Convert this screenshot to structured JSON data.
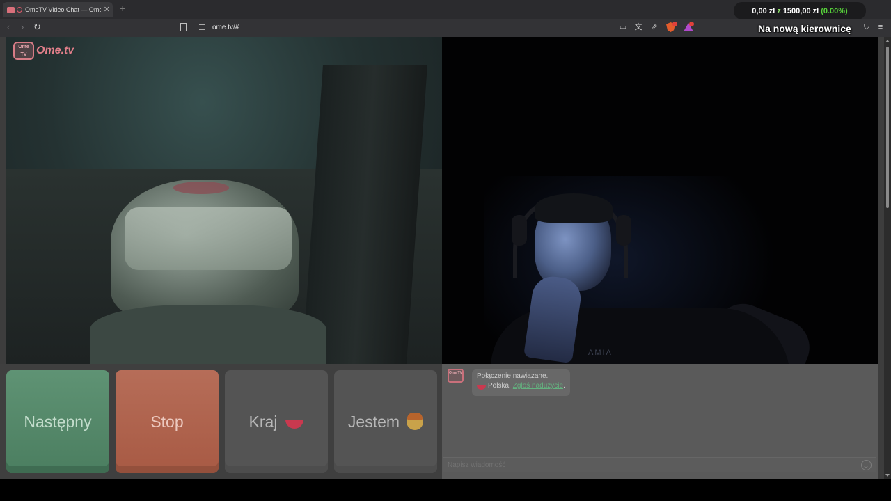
{
  "browser": {
    "tab_title": "OmeTV Video Chat — Omegle",
    "tab_close": "✕",
    "new_tab": "+",
    "url": "ome.tv/#",
    "nav": {
      "back": "‹",
      "forward": "›",
      "reload": "↻"
    },
    "toolbar_icons": [
      "screen-cast-icon",
      "translate-icon",
      "share-icon",
      "brave-shields-icon",
      "brave-rewards-icon",
      "sidebar-icon",
      "wallet-icon",
      "vpn-icon",
      "menu-icon"
    ]
  },
  "stream_overlay": {
    "amount": "0,00 zł",
    "z": "z",
    "goal": "1500,00 zł",
    "percent": "(0.00%)",
    "title": "Na nową kierownicę"
  },
  "site": {
    "logo_text": "Ome.tv",
    "logo_badge": "Ome TV"
  },
  "remote_video": {
    "shirt_text": "AMIA"
  },
  "controls": {
    "next_label": "Następny",
    "stop_label": "Stop",
    "country_label": "Kraj",
    "gender_label": "Jestem"
  },
  "chat": {
    "status": "Połączenie nawiązane.",
    "country": "Polska.",
    "report_link": "Zgłoś nadużycie",
    "report_suffix": ".",
    "input_placeholder": "Napisz wiadomość"
  },
  "colors": {
    "next": "#5f9374",
    "stop": "#b66d58",
    "logo": "#e27f8a",
    "report_link": "#63b27f",
    "overlay_green": "#57d13a"
  }
}
